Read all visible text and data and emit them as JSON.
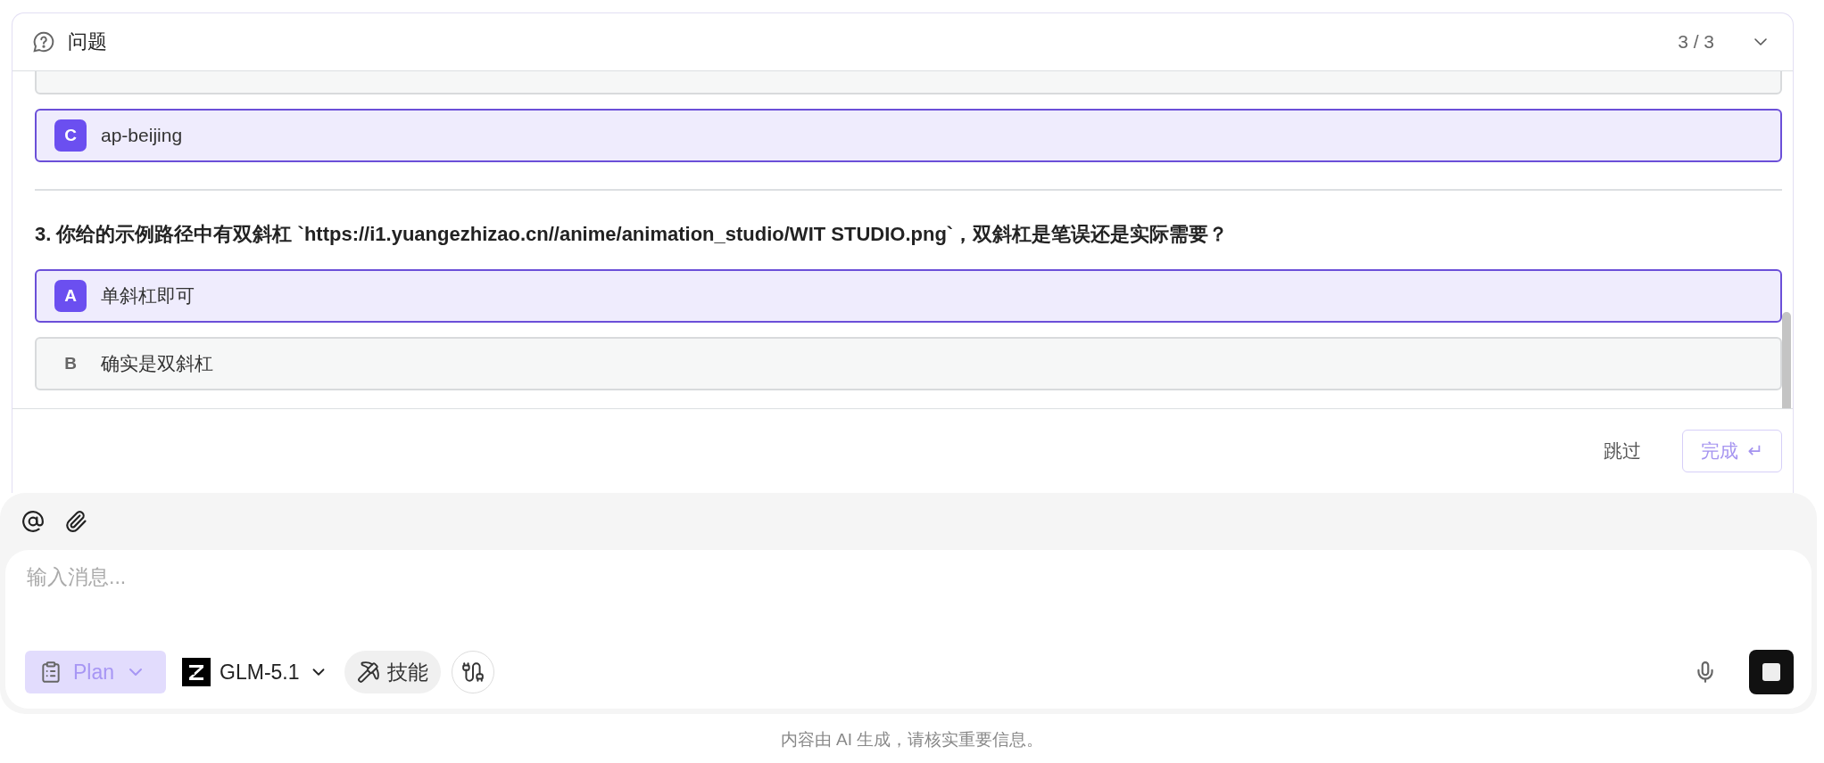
{
  "panel": {
    "title": "问题",
    "counter": "3 / 3",
    "expanded": true
  },
  "previous_options": [
    {
      "letter": "C",
      "text": "ap-beijing",
      "selected": true
    }
  ],
  "question": {
    "text": "3. 你给的示例路径中有双斜杠 `https://i1.yuangezhizao.cn//anime/animation_studio/WIT STUDIO.png`，双斜杠是笔误还是实际需要？",
    "options": [
      {
        "letter": "A",
        "text": "单斜杠即可",
        "selected": true
      },
      {
        "letter": "B",
        "text": "确实是双斜杠",
        "selected": false
      }
    ]
  },
  "actions": {
    "skip": "跳过",
    "finish": "完成",
    "finish_key": "↵",
    "finish_disabled": true
  },
  "composer": {
    "placeholder": "输入消息...",
    "mode": "Plan",
    "mode_active": true,
    "model": "GLM-5.1",
    "skills": "技能"
  },
  "disclaimer": "内容由 AI 生成，请核实重要信息。"
}
